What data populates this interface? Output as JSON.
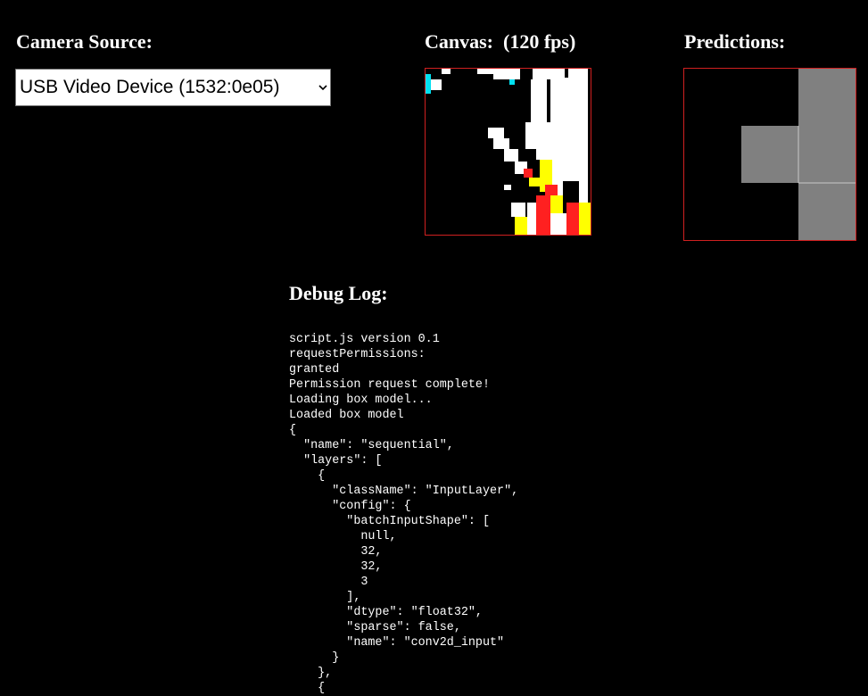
{
  "camera": {
    "heading": "Camera Source:",
    "selected_device": "USB Video Device (1532:0e05)"
  },
  "canvas": {
    "heading": "Canvas:  (120 fps)"
  },
  "predictions": {
    "heading": "Predictions:"
  },
  "debug": {
    "heading": "Debug Log:",
    "lines": [
      "script.js version 0.1",
      "requestPermissions:",
      "granted",
      "Permission request complete!",
      "Loading box model...",
      "Loaded box model",
      "{",
      "  \"name\": \"sequential\",",
      "  \"layers\": [",
      "    {",
      "      \"className\": \"InputLayer\",",
      "      \"config\": {",
      "        \"batchInputShape\": [",
      "          null,",
      "          32,",
      "          32,",
      "          3",
      "        ],",
      "        \"dtype\": \"float32\",",
      "        \"sparse\": false,",
      "        \"name\": \"conv2d_input\"",
      "      }",
      "    },",
      "    {"
    ]
  },
  "colors": {
    "background": "#000000",
    "canvas_border": "#d02020",
    "prediction_cell": "#808080"
  }
}
